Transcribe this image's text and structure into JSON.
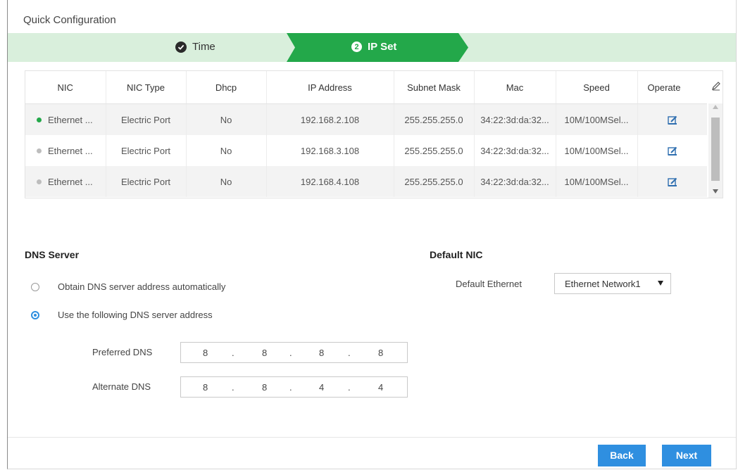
{
  "window": {
    "title": "Quick Configuration"
  },
  "steps": [
    {
      "label": "Time",
      "state": "done"
    },
    {
      "number": "2",
      "label": "IP Set",
      "state": "active"
    }
  ],
  "colors": {
    "accent": "#23a84a",
    "step_bg": "#d9efdc",
    "button": "#2f8fe0",
    "online": "#23a84a",
    "offline": "#bdbdbd"
  },
  "table": {
    "columns": [
      "NIC",
      "NIC Type",
      "Dhcp",
      "IP Address",
      "Subnet Mask",
      "Mac",
      "Speed",
      "Operate"
    ],
    "rows": [
      {
        "status": "online",
        "nic": "Ethernet ...",
        "type": "Electric Port",
        "dhcp": "No",
        "ip": "192.168.2.108",
        "mask": "255.255.255.0",
        "mac": "34:22:3d:da:32...",
        "speed": "10M/100MSel...",
        "operate_icon": "edit-icon"
      },
      {
        "status": "offline",
        "nic": "Ethernet ...",
        "type": "Electric Port",
        "dhcp": "No",
        "ip": "192.168.3.108",
        "mask": "255.255.255.0",
        "mac": "34:22:3d:da:32...",
        "speed": "10M/100MSel...",
        "operate_icon": "edit-icon"
      },
      {
        "status": "offline",
        "nic": "Ethernet ...",
        "type": "Electric Port",
        "dhcp": "No",
        "ip": "192.168.4.108",
        "mask": "255.255.255.0",
        "mac": "34:22:3d:da:32...",
        "speed": "10M/100MSel...",
        "operate_icon": "edit-icon"
      }
    ]
  },
  "dns": {
    "title": "DNS Server",
    "option_auto": "Obtain DNS server address automatically",
    "option_manual": "Use the following DNS server address",
    "selected": "manual",
    "preferred_label": "Preferred DNS",
    "preferred": [
      "8",
      "8",
      "8",
      "8"
    ],
    "alternate_label": "Alternate DNS",
    "alternate": [
      "8",
      "8",
      "4",
      "4"
    ]
  },
  "default_nic": {
    "title": "Default NIC",
    "label": "Default Ethernet",
    "value": "Ethernet Network1"
  },
  "buttons": {
    "back": "Back",
    "next": "Next"
  }
}
